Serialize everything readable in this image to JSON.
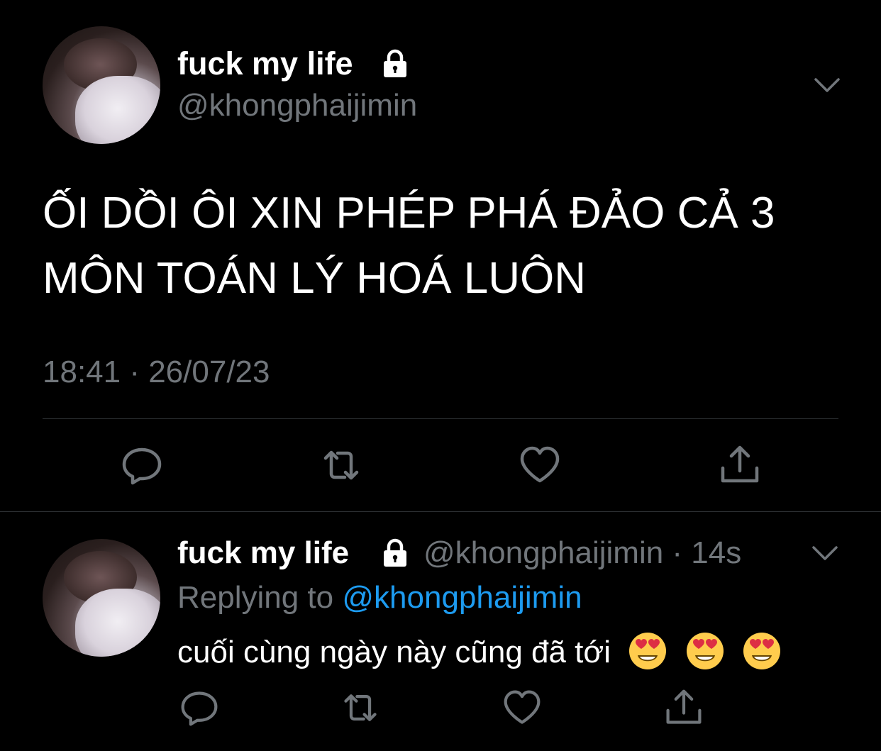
{
  "main_tweet": {
    "display_name": "fuck my life",
    "handle": "@khongphaijimin",
    "text_lines": [
      "ỐI DỒI ÔI XIN PHÉP PHÁ ĐẢO CẢ 3",
      "MÔN TOÁN LÝ HOÁ LUÔN"
    ],
    "timestamp": "18:41 · 26/07/23"
  },
  "reply": {
    "display_name": "fuck my life",
    "handle_meta": "@khongphaijimin · 14s",
    "replying_prefix": "Replying to",
    "replying_mention": "@khongphaijimin",
    "text": "cuối cùng ngày này cũng đã tới",
    "emoji_count": 3,
    "emoji_name": "smiling-face-with-heart-eyes"
  },
  "icons": {
    "reply": "reply-icon",
    "retweet": "retweet-icon",
    "like": "like-icon",
    "share": "share-icon",
    "lock": "lock-icon",
    "more": "chevron-down-icon"
  },
  "colors": {
    "background": "#000000",
    "text_primary": "#ffffff",
    "text_secondary": "#71767b",
    "link": "#1d9bf0",
    "divider": "#2f3336"
  }
}
